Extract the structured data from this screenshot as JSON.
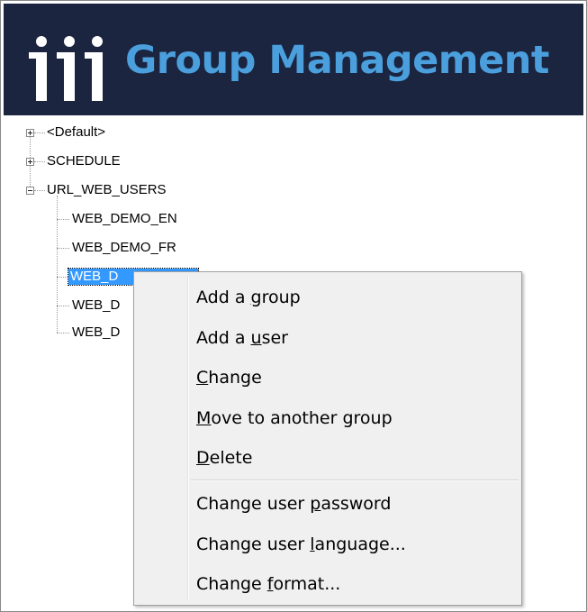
{
  "header": {
    "title": "Group Management",
    "logo_icon": "iii-logo-icon"
  },
  "tree": {
    "roots": [
      {
        "label": "<Default>",
        "expanded": false
      },
      {
        "label": "SCHEDULE",
        "expanded": false
      },
      {
        "label": "URL_WEB_USERS",
        "expanded": true
      }
    ],
    "children": [
      {
        "label": "WEB_DEMO_EN",
        "selected": false
      },
      {
        "label": "WEB_DEMO_FR",
        "selected": false
      },
      {
        "label": "WEB_D",
        "selected": true
      },
      {
        "label": "WEB_D",
        "selected": false
      },
      {
        "label": "WEB_D",
        "selected": false
      }
    ]
  },
  "context_menu": {
    "items": [
      {
        "label": "Add a group",
        "mnemonic": "g"
      },
      {
        "label": "Add a user",
        "mnemonic": "u"
      },
      {
        "label": "Change",
        "mnemonic": "C"
      },
      {
        "label": "Move to another group",
        "mnemonic": "M"
      },
      {
        "label": "Delete",
        "mnemonic": "D"
      },
      {
        "label": "Change user password",
        "mnemonic": "p"
      },
      {
        "label": "Change user language...",
        "mnemonic": "l"
      },
      {
        "label": "Change format...",
        "mnemonic": "f"
      }
    ]
  },
  "colors": {
    "header_bg": "#1b2540",
    "title_blue": "#4a9fdc",
    "selection": "#3399ff"
  }
}
